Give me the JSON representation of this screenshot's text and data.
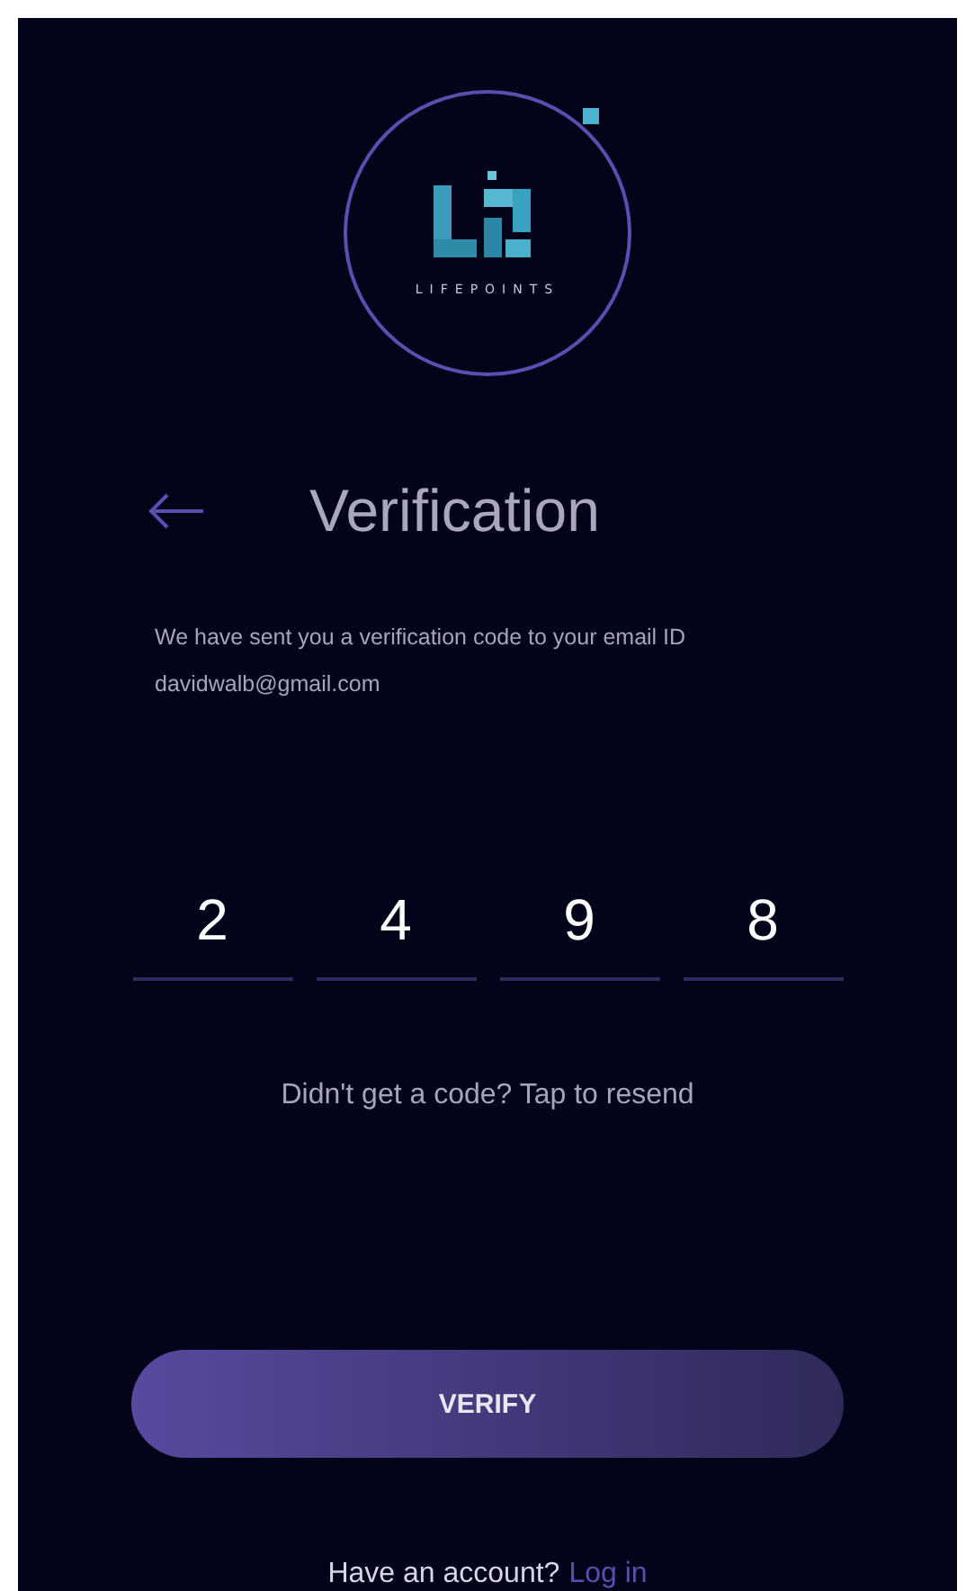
{
  "logo": {
    "wordmark": "LIFEPOINTS"
  },
  "header": {
    "title": "Verification"
  },
  "message": {
    "text": "We have sent you a verification code to your email ID",
    "email": "davidwalb@gmail.com"
  },
  "code_digits": [
    "2",
    "4",
    "9",
    "8"
  ],
  "resend": {
    "text": "Didn't get a code? Tap to resend"
  },
  "verify_button": {
    "label": "VERIFY"
  },
  "footer": {
    "text": "Have an account?",
    "link": "Log in"
  }
}
